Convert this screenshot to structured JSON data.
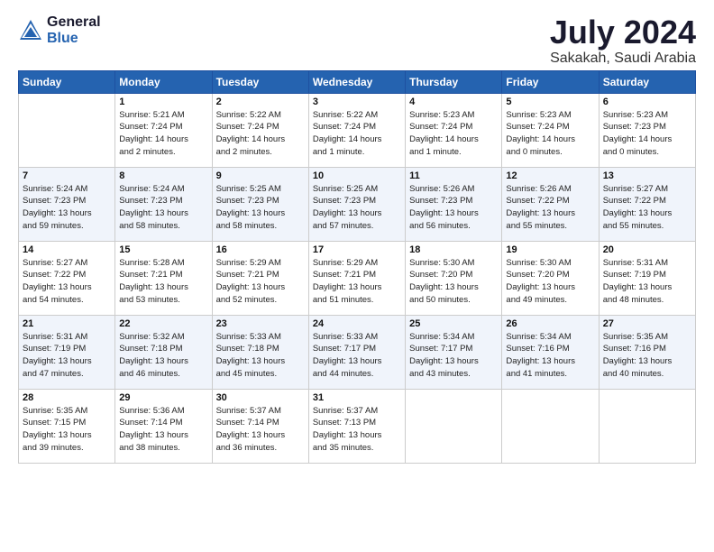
{
  "header": {
    "logo_general": "General",
    "logo_blue": "Blue",
    "month_title": "July 2024",
    "location": "Sakakah, Saudi Arabia"
  },
  "weekdays": [
    "Sunday",
    "Monday",
    "Tuesday",
    "Wednesday",
    "Thursday",
    "Friday",
    "Saturday"
  ],
  "weeks": [
    [
      {
        "day": "",
        "info": ""
      },
      {
        "day": "1",
        "info": "Sunrise: 5:21 AM\nSunset: 7:24 PM\nDaylight: 14 hours\nand 2 minutes."
      },
      {
        "day": "2",
        "info": "Sunrise: 5:22 AM\nSunset: 7:24 PM\nDaylight: 14 hours\nand 2 minutes."
      },
      {
        "day": "3",
        "info": "Sunrise: 5:22 AM\nSunset: 7:24 PM\nDaylight: 14 hours\nand 1 minute."
      },
      {
        "day": "4",
        "info": "Sunrise: 5:23 AM\nSunset: 7:24 PM\nDaylight: 14 hours\nand 1 minute."
      },
      {
        "day": "5",
        "info": "Sunrise: 5:23 AM\nSunset: 7:24 PM\nDaylight: 14 hours\nand 0 minutes."
      },
      {
        "day": "6",
        "info": "Sunrise: 5:23 AM\nSunset: 7:23 PM\nDaylight: 14 hours\nand 0 minutes."
      }
    ],
    [
      {
        "day": "7",
        "info": "Sunrise: 5:24 AM\nSunset: 7:23 PM\nDaylight: 13 hours\nand 59 minutes."
      },
      {
        "day": "8",
        "info": "Sunrise: 5:24 AM\nSunset: 7:23 PM\nDaylight: 13 hours\nand 58 minutes."
      },
      {
        "day": "9",
        "info": "Sunrise: 5:25 AM\nSunset: 7:23 PM\nDaylight: 13 hours\nand 58 minutes."
      },
      {
        "day": "10",
        "info": "Sunrise: 5:25 AM\nSunset: 7:23 PM\nDaylight: 13 hours\nand 57 minutes."
      },
      {
        "day": "11",
        "info": "Sunrise: 5:26 AM\nSunset: 7:23 PM\nDaylight: 13 hours\nand 56 minutes."
      },
      {
        "day": "12",
        "info": "Sunrise: 5:26 AM\nSunset: 7:22 PM\nDaylight: 13 hours\nand 55 minutes."
      },
      {
        "day": "13",
        "info": "Sunrise: 5:27 AM\nSunset: 7:22 PM\nDaylight: 13 hours\nand 55 minutes."
      }
    ],
    [
      {
        "day": "14",
        "info": "Sunrise: 5:27 AM\nSunset: 7:22 PM\nDaylight: 13 hours\nand 54 minutes."
      },
      {
        "day": "15",
        "info": "Sunrise: 5:28 AM\nSunset: 7:21 PM\nDaylight: 13 hours\nand 53 minutes."
      },
      {
        "day": "16",
        "info": "Sunrise: 5:29 AM\nSunset: 7:21 PM\nDaylight: 13 hours\nand 52 minutes."
      },
      {
        "day": "17",
        "info": "Sunrise: 5:29 AM\nSunset: 7:21 PM\nDaylight: 13 hours\nand 51 minutes."
      },
      {
        "day": "18",
        "info": "Sunrise: 5:30 AM\nSunset: 7:20 PM\nDaylight: 13 hours\nand 50 minutes."
      },
      {
        "day": "19",
        "info": "Sunrise: 5:30 AM\nSunset: 7:20 PM\nDaylight: 13 hours\nand 49 minutes."
      },
      {
        "day": "20",
        "info": "Sunrise: 5:31 AM\nSunset: 7:19 PM\nDaylight: 13 hours\nand 48 minutes."
      }
    ],
    [
      {
        "day": "21",
        "info": "Sunrise: 5:31 AM\nSunset: 7:19 PM\nDaylight: 13 hours\nand 47 minutes."
      },
      {
        "day": "22",
        "info": "Sunrise: 5:32 AM\nSunset: 7:18 PM\nDaylight: 13 hours\nand 46 minutes."
      },
      {
        "day": "23",
        "info": "Sunrise: 5:33 AM\nSunset: 7:18 PM\nDaylight: 13 hours\nand 45 minutes."
      },
      {
        "day": "24",
        "info": "Sunrise: 5:33 AM\nSunset: 7:17 PM\nDaylight: 13 hours\nand 44 minutes."
      },
      {
        "day": "25",
        "info": "Sunrise: 5:34 AM\nSunset: 7:17 PM\nDaylight: 13 hours\nand 43 minutes."
      },
      {
        "day": "26",
        "info": "Sunrise: 5:34 AM\nSunset: 7:16 PM\nDaylight: 13 hours\nand 41 minutes."
      },
      {
        "day": "27",
        "info": "Sunrise: 5:35 AM\nSunset: 7:16 PM\nDaylight: 13 hours\nand 40 minutes."
      }
    ],
    [
      {
        "day": "28",
        "info": "Sunrise: 5:35 AM\nSunset: 7:15 PM\nDaylight: 13 hours\nand 39 minutes."
      },
      {
        "day": "29",
        "info": "Sunrise: 5:36 AM\nSunset: 7:14 PM\nDaylight: 13 hours\nand 38 minutes."
      },
      {
        "day": "30",
        "info": "Sunrise: 5:37 AM\nSunset: 7:14 PM\nDaylight: 13 hours\nand 36 minutes."
      },
      {
        "day": "31",
        "info": "Sunrise: 5:37 AM\nSunset: 7:13 PM\nDaylight: 13 hours\nand 35 minutes."
      },
      {
        "day": "",
        "info": ""
      },
      {
        "day": "",
        "info": ""
      },
      {
        "day": "",
        "info": ""
      }
    ]
  ]
}
